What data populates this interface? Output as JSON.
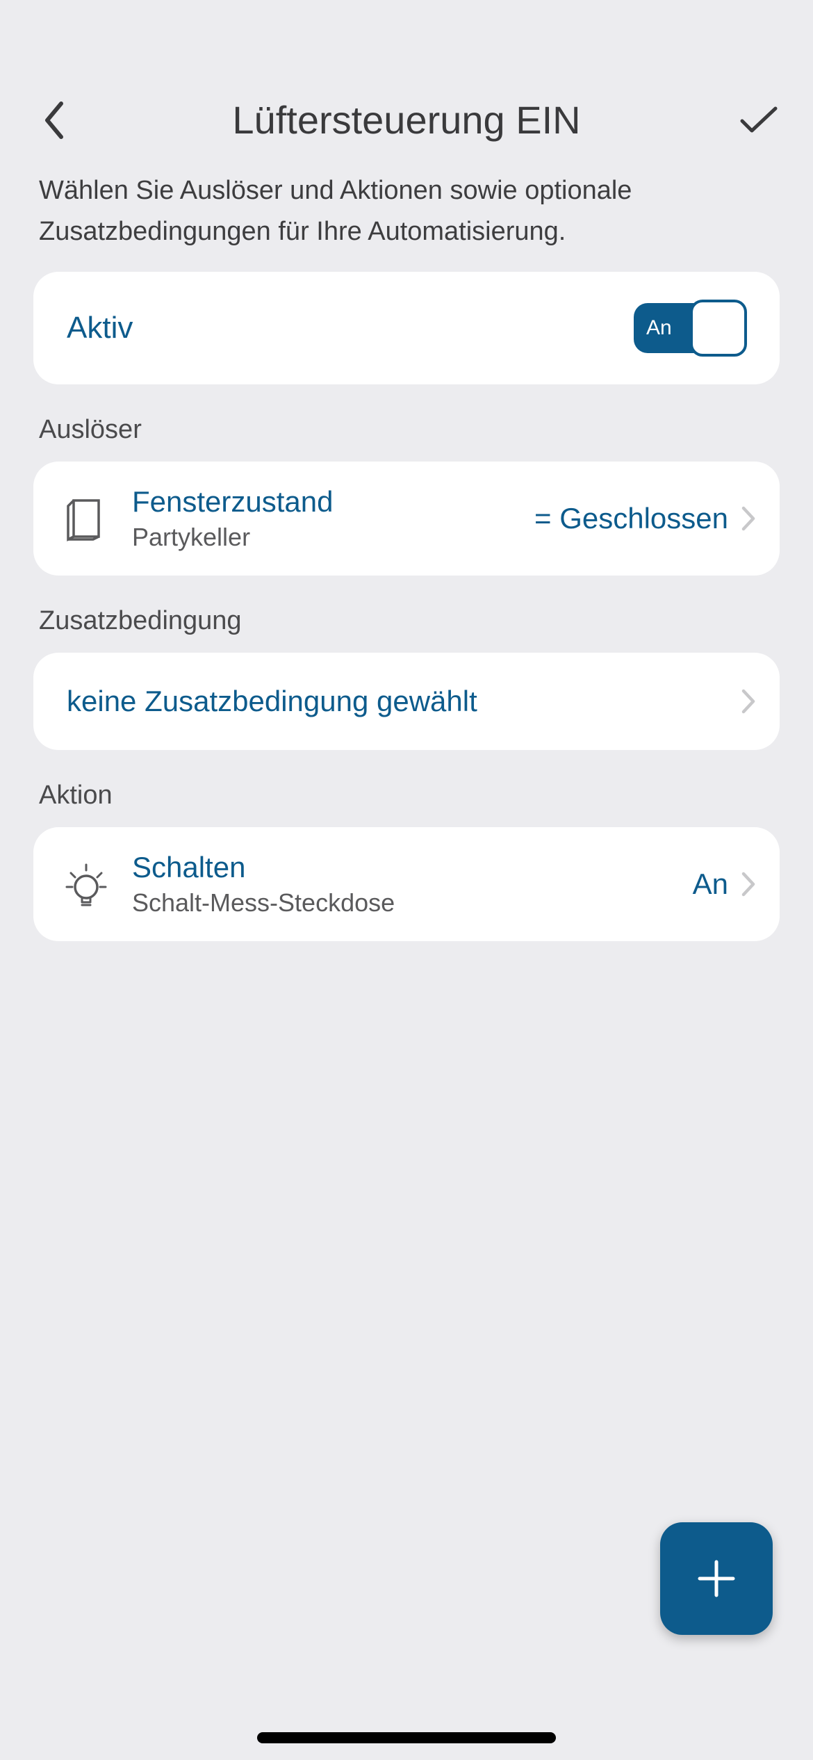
{
  "header": {
    "title": "Lüftersteuerung EIN"
  },
  "description": "Wählen Sie Auslöser und Aktionen sowie optionale Zusatzbedingungen für Ihre Automatisierung.",
  "active": {
    "label": "Aktiv",
    "toggle_label": "An"
  },
  "sections": {
    "trigger": {
      "heading": "Auslöser",
      "item": {
        "title": "Fensterzustand",
        "subtitle": "Partykeller",
        "value": "= Geschlossen"
      }
    },
    "condition": {
      "heading": "Zusatzbedingung",
      "text": "keine Zusatzbedingung gewählt"
    },
    "action": {
      "heading": "Aktion",
      "item": {
        "title": "Schalten",
        "subtitle": "Schalt-Mess-Steckdose",
        "value": "An"
      }
    }
  },
  "colors": {
    "accent": "#0d5b8c",
    "background": "#ececef",
    "card": "#ffffff",
    "text_primary": "#3a3a3c",
    "text_secondary": "#5a5a5c"
  }
}
